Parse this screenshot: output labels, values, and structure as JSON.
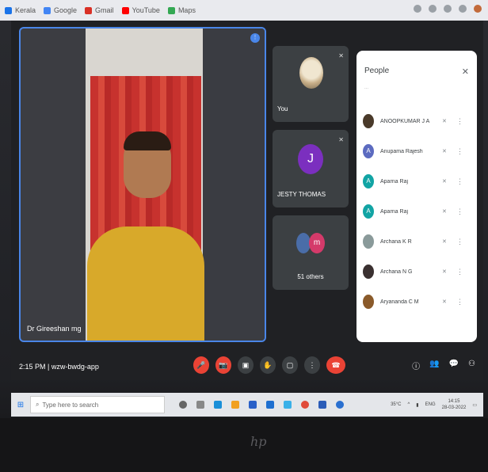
{
  "browser": {
    "bookmarks": [
      {
        "label": "Kerala",
        "color": "#1a73e8"
      },
      {
        "label": "Google",
        "color": "#4285f4"
      },
      {
        "label": "Gmail",
        "color": "#d93025"
      },
      {
        "label": "YouTube",
        "color": "#ff0000"
      },
      {
        "label": "Maps",
        "color": "#34a853"
      }
    ]
  },
  "main_tile": {
    "name": "Dr Gireeshan mg"
  },
  "side_tiles": {
    "you": {
      "label": "You"
    },
    "jesty": {
      "label": "JESTY THOMAS",
      "initial": "J"
    },
    "others": {
      "label": "51 others",
      "initial": "m"
    }
  },
  "people_panel": {
    "title": "People",
    "close": "✕",
    "search_hint": "...",
    "participants": [
      {
        "name": "ANOOPKUMAR J A",
        "initial": "",
        "color": "#4a3a2a"
      },
      {
        "name": "Anupama Rajesh",
        "initial": "A",
        "color": "#5c6bc0"
      },
      {
        "name": "Aparna Raj",
        "initial": "A",
        "color": "#12a4a4"
      },
      {
        "name": "Aparna Raj",
        "initial": "A",
        "color": "#12a4a4"
      },
      {
        "name": "Archana K R",
        "initial": "",
        "color": "#8a9a9a"
      },
      {
        "name": "Archana N G",
        "initial": "",
        "color": "#3a3030"
      },
      {
        "name": "Aryananda C M",
        "initial": "",
        "color": "#8a5a2a"
      }
    ]
  },
  "meeting": {
    "time": "2:15 PM",
    "separator": "|",
    "code": "wzw-bwdg-app"
  },
  "controls": [
    "🎤",
    "📷",
    "▣",
    "✋",
    "▢",
    "⋮",
    "☎"
  ],
  "right_icons": [
    "ⓘ",
    "👥",
    "💬",
    "⚇"
  ],
  "taskbar": {
    "search_placeholder": "Type here to search",
    "weather": "35°C",
    "lang": "ENG",
    "time": "14:15",
    "date": "28-03-2022"
  },
  "brand": "hp"
}
